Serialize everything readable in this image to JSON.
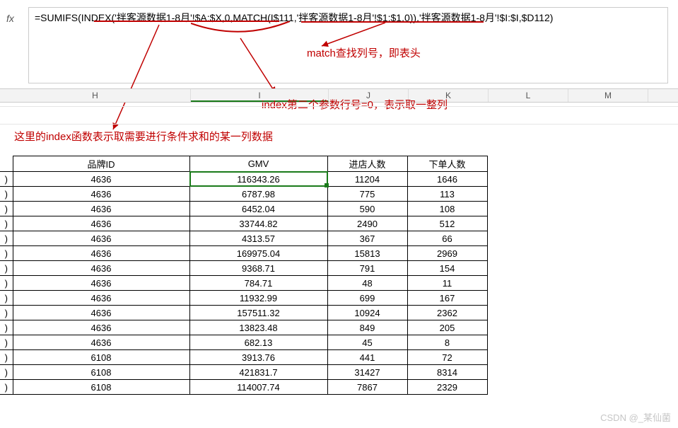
{
  "formula_bar": {
    "fx": "fx",
    "formula": "=SUMIFS(INDEX('拌客源数据1-8月'!$A:$X,0,MATCH(I$111,'拌客源数据1-8月'!$1:$1,0)),'拌客源数据1-8月'!$I:$I,$D112)"
  },
  "annotations": {
    "match_note": "match查找列号，即表头",
    "index_note": "index第二个参数行号=0，表示取一整列",
    "left_note": "这里的index函数表示取需要进行条件求和的某一列数据"
  },
  "columns": {
    "H": "H",
    "I": "I",
    "J": "J",
    "K": "K",
    "L": "L",
    "M": "M"
  },
  "table": {
    "headers": [
      "品牌ID",
      "GMV",
      "进店人数",
      "下单人数"
    ],
    "rowPrefix": ")",
    "rows": [
      [
        "4636",
        "116343.26",
        "11204",
        "1646"
      ],
      [
        "4636",
        "6787.98",
        "775",
        "113"
      ],
      [
        "4636",
        "6452.04",
        "590",
        "108"
      ],
      [
        "4636",
        "33744.82",
        "2490",
        "512"
      ],
      [
        "4636",
        "4313.57",
        "367",
        "66"
      ],
      [
        "4636",
        "169975.04",
        "15813",
        "2969"
      ],
      [
        "4636",
        "9368.71",
        "791",
        "154"
      ],
      [
        "4636",
        "784.71",
        "48",
        "11"
      ],
      [
        "4636",
        "11932.99",
        "699",
        "167"
      ],
      [
        "4636",
        "157511.32",
        "10924",
        "2362"
      ],
      [
        "4636",
        "13823.48",
        "849",
        "205"
      ],
      [
        "4636",
        "682.13",
        "45",
        "8"
      ],
      [
        "6108",
        "3913.76",
        "441",
        "72"
      ],
      [
        "6108",
        "421831.7",
        "31427",
        "8314"
      ],
      [
        "6108",
        "114007.74",
        "7867",
        "2329"
      ]
    ]
  },
  "watermark": "CSDN @_某仙菌",
  "chart_data": {
    "type": "table",
    "table": {
      "columns": [
        "品牌ID",
        "GMV",
        "进店人数",
        "下单人数"
      ],
      "data": [
        [
          4636,
          116343.26,
          11204,
          1646
        ],
        [
          4636,
          6787.98,
          775,
          113
        ],
        [
          4636,
          6452.04,
          590,
          108
        ],
        [
          4636,
          33744.82,
          2490,
          512
        ],
        [
          4636,
          4313.57,
          367,
          66
        ],
        [
          4636,
          169975.04,
          15813,
          2969
        ],
        [
          4636,
          9368.71,
          791,
          154
        ],
        [
          4636,
          784.71,
          48,
          11
        ],
        [
          4636,
          11932.99,
          699,
          167
        ],
        [
          4636,
          157511.32,
          10924,
          2362
        ],
        [
          4636,
          13823.48,
          849,
          205
        ],
        [
          4636,
          682.13,
          45,
          8
        ],
        [
          6108,
          3913.76,
          441,
          72
        ],
        [
          6108,
          421831.7,
          31427,
          8314
        ],
        [
          6108,
          114007.74,
          7867,
          2329
        ]
      ]
    }
  }
}
